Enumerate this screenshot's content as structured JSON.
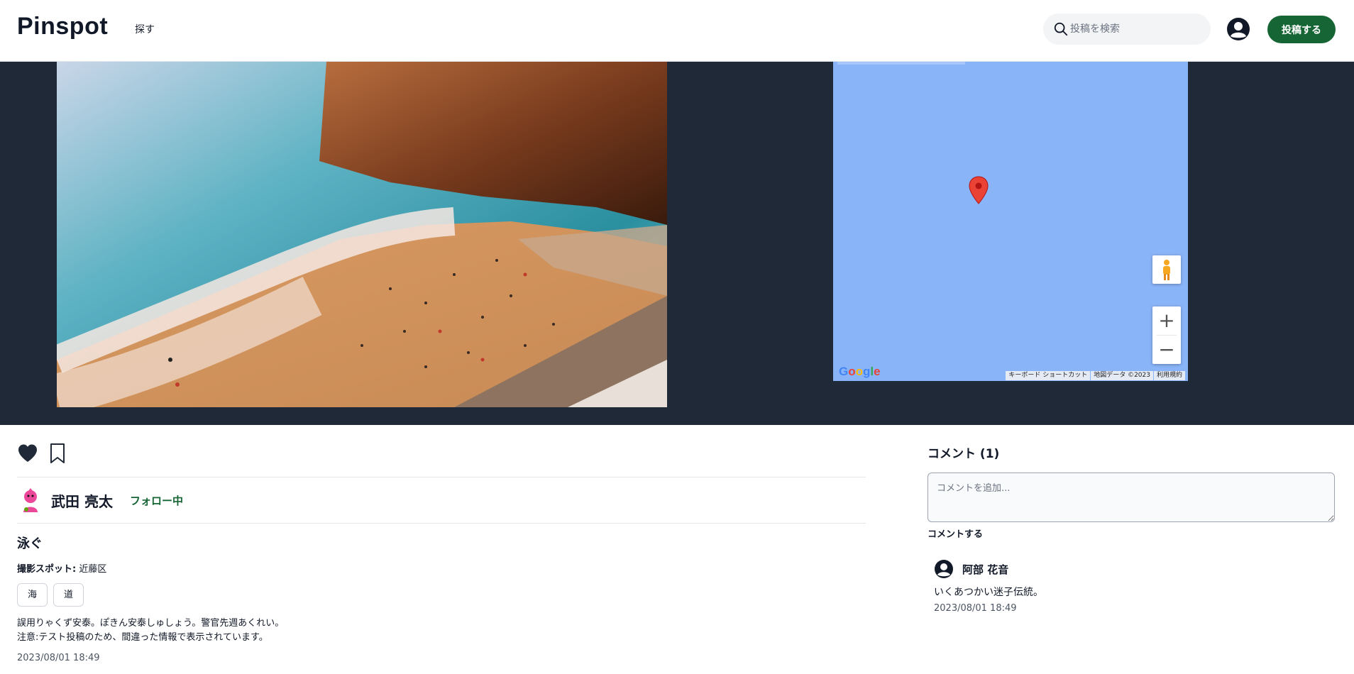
{
  "header": {
    "brand": "Pinspot",
    "nav_explore": "探す",
    "search_placeholder": "投稿を検索",
    "post_button": "投稿する"
  },
  "map": {
    "google_logo": "Google",
    "footer": [
      "キーボード ショートカット",
      "地図データ ©2023",
      "利用規約"
    ],
    "marker_color": "#ea4335",
    "water_color": "#8ab4f8"
  },
  "post": {
    "author_name": "武田 亮太",
    "follow_status": "フォロー中",
    "title": "泳ぐ",
    "spot_label": "撮影スポット:",
    "spot_value": " 近藤区",
    "tags": [
      "海",
      "道"
    ],
    "description_lines": [
      "誤用りゃくず安泰。ぽきん安泰しゅしょう。警官先週あくれい。",
      "注意:テスト投稿のため、間違った情報で表示されています。"
    ],
    "date": "2023/08/01 18:49"
  },
  "comments": {
    "title": "コメント (1)",
    "input_placeholder": "コメントを追加...",
    "submit_label": "コメントする",
    "items": [
      {
        "author": "阿部 花音",
        "body": "いくあつかい迷子伝統。",
        "time": "2023/08/01 18:49"
      }
    ]
  },
  "colors": {
    "accent": "#166534",
    "hero_bg": "#1f2937"
  }
}
